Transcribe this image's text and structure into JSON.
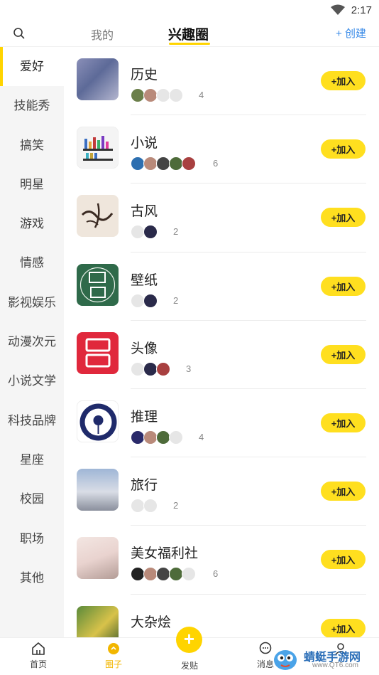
{
  "status_bar": {
    "time": "2:17"
  },
  "header": {
    "tabs": [
      {
        "label": "我的"
      },
      {
        "label": "兴趣圈"
      }
    ],
    "create_label": "+ 创建"
  },
  "sidebar": {
    "categories": [
      "爱好",
      "技能秀",
      "搞笑",
      "明星",
      "游戏",
      "情感",
      "影视娱乐",
      "动漫次元",
      "小说文学",
      "科技品牌",
      "星座",
      "校园",
      "职场",
      "其他"
    ]
  },
  "join_label": "+加入",
  "circles": [
    {
      "name": "历史",
      "member_count": "4"
    },
    {
      "name": "小说",
      "member_count": "6"
    },
    {
      "name": "古风",
      "member_count": "2"
    },
    {
      "name": "壁纸",
      "member_count": "2"
    },
    {
      "name": "头像",
      "member_count": "3"
    },
    {
      "name": "推理",
      "member_count": "4"
    },
    {
      "name": "旅行",
      "member_count": "2"
    },
    {
      "name": "美女福利社",
      "member_count": "6"
    },
    {
      "name": "大杂烩",
      "member_count": ""
    }
  ],
  "bottom_nav": {
    "home": "首页",
    "circle": "圈子",
    "post": "发贴",
    "messages": "消息",
    "post_icon": "+"
  },
  "watermark": {
    "name": "蜻蜓手游网",
    "url": "www.QT6.com"
  },
  "colors": {
    "accent": "#ffd400",
    "link": "#3a8be8",
    "active_nav": "#f2b600"
  }
}
